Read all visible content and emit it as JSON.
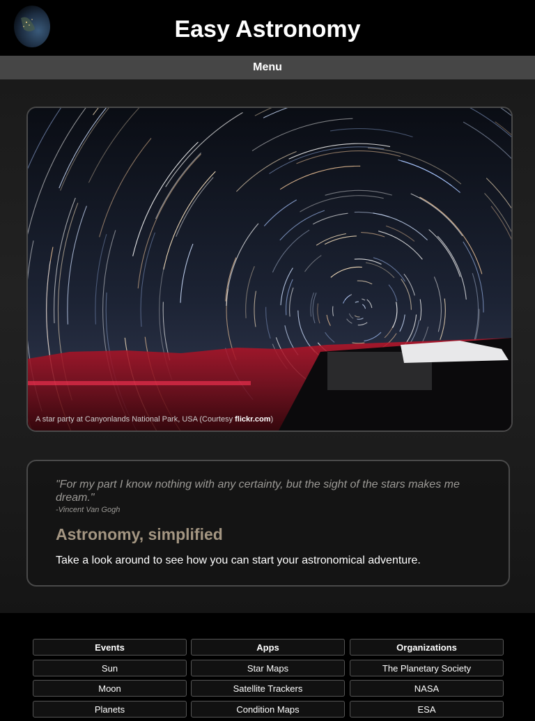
{
  "header": {
    "title": "Easy Astronomy",
    "logo_icon": "earth-globe-icon"
  },
  "menu": {
    "label": "Menu"
  },
  "hero": {
    "caption_prefix": "A star party at Canyonlands National Park, USA (Courtesy ",
    "caption_link": "flickr.com",
    "caption_suffix": ")"
  },
  "intro": {
    "quote": "\"For my part I know nothing with any certainty, but the sight of the stars makes me dream.\"",
    "quote_author": "-Vincent Van Gogh",
    "headline": "Astronomy, simplified",
    "text": "Take a look around to see how you can start your astronomical adventure."
  },
  "footer": {
    "columns": [
      {
        "items": [
          "Events",
          "Sun",
          "Moon",
          "Planets"
        ]
      },
      {
        "items": [
          "Apps",
          "Star Maps",
          "Satellite Trackers",
          "Condition Maps"
        ]
      },
      {
        "items": [
          "Organizations",
          "The Planetary Society",
          "NASA",
          "ESA"
        ]
      }
    ]
  },
  "colors": {
    "menu_bar": "#464646",
    "headline": "#a49682",
    "quote": "#9c9a96"
  }
}
